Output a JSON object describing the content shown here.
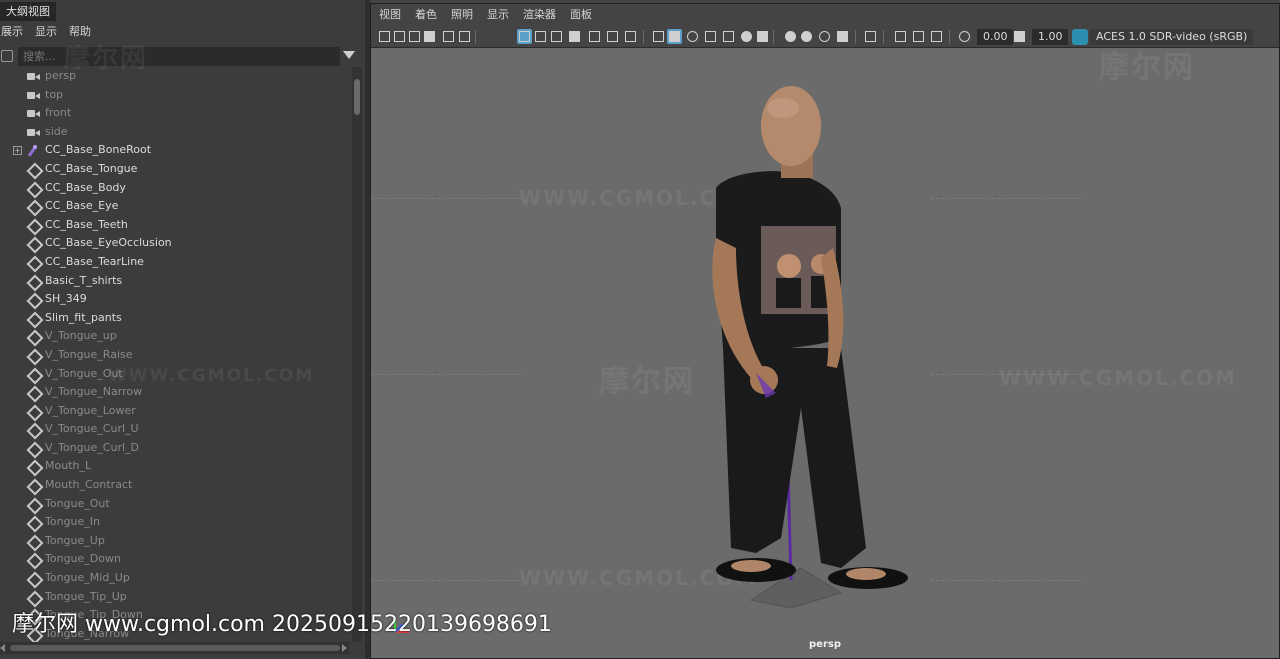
{
  "outliner": {
    "title": "大纲视图",
    "menu": [
      "展示",
      "显示",
      "帮助"
    ],
    "search_placeholder": "搜索...",
    "items": [
      {
        "label": "persp",
        "icon": "camera-icon",
        "state": "dim"
      },
      {
        "label": "top",
        "icon": "camera-icon",
        "state": "dim"
      },
      {
        "label": "front",
        "icon": "camera-icon",
        "state": "dim"
      },
      {
        "label": "side",
        "icon": "camera-icon",
        "state": "dim"
      },
      {
        "label": "CC_Base_BoneRoot",
        "icon": "joint-icon",
        "state": "active",
        "expandable": true
      },
      {
        "label": "CC_Base_Tongue",
        "icon": "mesh-icon",
        "state": "active"
      },
      {
        "label": "CC_Base_Body",
        "icon": "mesh-icon",
        "state": "active"
      },
      {
        "label": "CC_Base_Eye",
        "icon": "mesh-icon",
        "state": "active"
      },
      {
        "label": "CC_Base_Teeth",
        "icon": "mesh-icon",
        "state": "active"
      },
      {
        "label": "CC_Base_EyeOcclusion",
        "icon": "mesh-icon",
        "state": "active"
      },
      {
        "label": "CC_Base_TearLine",
        "icon": "mesh-icon",
        "state": "active"
      },
      {
        "label": "Basic_T_shirts",
        "icon": "mesh-icon",
        "state": "active"
      },
      {
        "label": "SH_349",
        "icon": "mesh-icon",
        "state": "active"
      },
      {
        "label": "Slim_fit_pants",
        "icon": "mesh-icon",
        "state": "active"
      },
      {
        "label": "V_Tongue_up",
        "icon": "mesh-icon",
        "state": "dim"
      },
      {
        "label": "V_Tongue_Raise",
        "icon": "mesh-icon",
        "state": "dim"
      },
      {
        "label": "V_Tongue_Out",
        "icon": "mesh-icon",
        "state": "dim"
      },
      {
        "label": "V_Tongue_Narrow",
        "icon": "mesh-icon",
        "state": "dim"
      },
      {
        "label": "V_Tongue_Lower",
        "icon": "mesh-icon",
        "state": "dim"
      },
      {
        "label": "V_Tongue_Curl_U",
        "icon": "mesh-icon",
        "state": "dim"
      },
      {
        "label": "V_Tongue_Curl_D",
        "icon": "mesh-icon",
        "state": "dim"
      },
      {
        "label": "Mouth_L",
        "icon": "mesh-icon",
        "state": "dim"
      },
      {
        "label": "Mouth_Contract",
        "icon": "mesh-icon",
        "state": "dim"
      },
      {
        "label": "Tongue_Out",
        "icon": "mesh-icon",
        "state": "dim"
      },
      {
        "label": "Tongue_In",
        "icon": "mesh-icon",
        "state": "dim"
      },
      {
        "label": "Tongue_Up",
        "icon": "mesh-icon",
        "state": "dim"
      },
      {
        "label": "Tongue_Down",
        "icon": "mesh-icon",
        "state": "dim"
      },
      {
        "label": "Tongue_Mid_Up",
        "icon": "mesh-icon",
        "state": "dim"
      },
      {
        "label": "Tongue_Tip_Up",
        "icon": "mesh-icon",
        "state": "dim"
      },
      {
        "label": "Tongue_Tip_Down",
        "icon": "mesh-icon",
        "state": "dim"
      },
      {
        "label": "Tongue_Narrow",
        "icon": "mesh-icon",
        "state": "dim"
      }
    ]
  },
  "viewport": {
    "menu": [
      "视图",
      "着色",
      "照明",
      "显示",
      "渲染器",
      "面板"
    ],
    "exposure_value": "0.00",
    "gamma_value": "1.00",
    "color_space": "ACES 1.0 SDR-video (sRGB)",
    "camera_label": "persp",
    "accent_color": "#5aa0c8"
  },
  "overlay": {
    "watermark_line": "摩尔网 www.cgmol.com 20250915220139698691",
    "background_watermark": "WWW.CGMOL.COM",
    "background_logo": "摩尔网"
  }
}
